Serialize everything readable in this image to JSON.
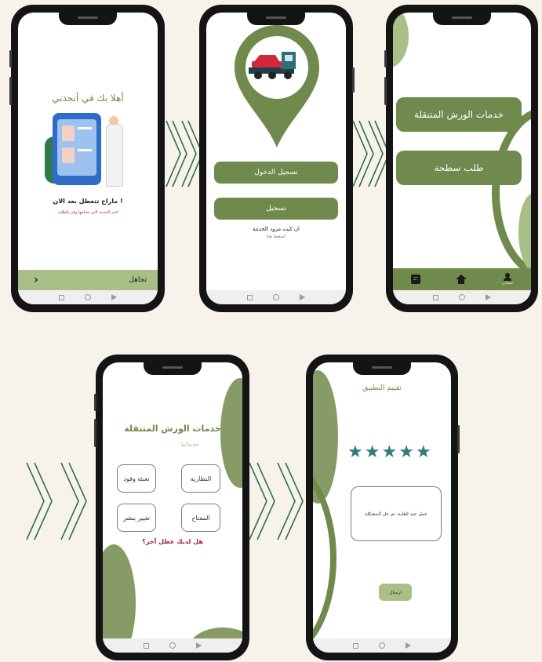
{
  "screen1": {
    "welcome": "أهلا بك في أنجدني",
    "question": "ماراح تتعطل بعد الان !",
    "subtitle": "اختر الخدمة التي تحتاجها وقم بالطلب",
    "skip_label": "تجاهل",
    "next_icon": "chevron-right-icon"
  },
  "screen2": {
    "login_label": "تسجيل الدخول",
    "register_label": "تسجيل",
    "provider_text": "ان كنت مزود الخدمة",
    "provider_link": "اضغط هنا"
  },
  "screen3": {
    "mobile_workshops_label": "خدمات الورش المتنقلة",
    "tow_truck_label": "طلب سطحة",
    "profile_label": "حسابي",
    "icons": [
      "notes-icon",
      "home-icon",
      "person-icon"
    ]
  },
  "screen4": {
    "title": "خدمات الورش المتنقلة",
    "subtitle": "خدماتنا",
    "services": {
      "battery": "البطارية",
      "fuel": "تعبئة وقود",
      "key": "المفتاح",
      "tire": "تغيير بنشر"
    },
    "other_issue": "هل لديك عطل آخر؟"
  },
  "screen5": {
    "title": "تقييم التطبيق",
    "stars": 5,
    "review_text": "عمل جيد للغاية، تم حل المشكلة",
    "send_label": "ارسال"
  },
  "colors": {
    "primary_green": "#6f8a4c",
    "light_green": "#869b66",
    "star_teal": "#2f7f79",
    "accent_red": "#a0243f",
    "background": "#f7f3ea"
  }
}
